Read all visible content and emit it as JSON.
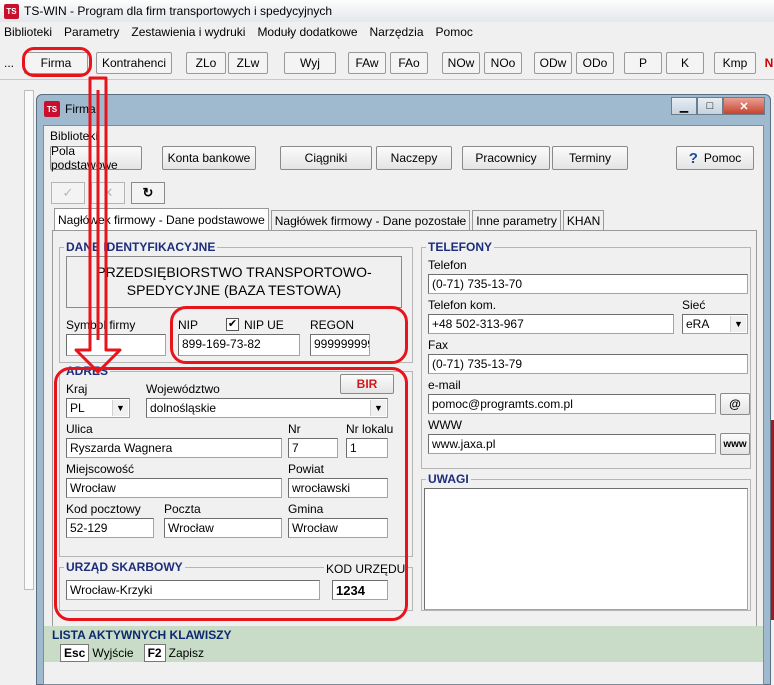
{
  "app": {
    "title": "TS-WIN - Program dla firm transportowych i spedycyjnych",
    "logo": "TS",
    "menu": [
      "Biblioteki",
      "Parametry",
      "Zestawienia i wydruki",
      "Moduły dodatkowe",
      "Narzędzia",
      "Pomoc"
    ],
    "toolbar": [
      "...",
      "Firma",
      "Kontrahenci",
      "ZLo",
      "ZLw",
      "Wyj",
      "FAw",
      "FAo",
      "NOw",
      "NOo",
      "ODw",
      "ODo",
      "P",
      "K",
      "Kmp",
      "N"
    ]
  },
  "window": {
    "title": "Firma",
    "menu": [
      "Biblioteki"
    ],
    "buttons": [
      "Pola podstawowe",
      "Konta bankowe",
      "Ciągniki",
      "Naczepy",
      "Pracownicy",
      "Terminy",
      "Pomoc"
    ],
    "tabs": [
      "Nagłówek firmowy - Dane podstawowe",
      "Nagłówek firmowy - Dane pozostałe",
      "Inne parametry",
      "KHAN"
    ]
  },
  "identification": {
    "title": "DANE IDENTYFIKACYJNE",
    "company_name": "PRZEDSIĘBIORSTWO TRANSPORTOWO-SPEDYCYJNE (BAZA TESTOWA)",
    "symbol_label": "Symbol firmy",
    "symbol_value": "",
    "nip_label": "NIP",
    "nip_ue_label": "NIP UE",
    "nip_ue_checked": "✔",
    "nip_value": "899-169-73-82",
    "regon_label": "REGON",
    "regon_value": "999999999"
  },
  "address": {
    "title": "ADRES",
    "bir_label": "BIR",
    "country_label": "Kraj",
    "country_value": "PL",
    "voivodeship_label": "Województwo",
    "voivodeship_value": "dolnośląskie",
    "street_label": "Ulica",
    "street_value": "Ryszarda Wagnera",
    "number_label": "Nr",
    "number_value": "7",
    "unit_label": "Nr lokalu",
    "unit_value": "1",
    "city_label": "Miejscowość",
    "city_value": "Wrocław",
    "county_label": "Powiat",
    "county_value": "wrocławski",
    "postal_label": "Kod pocztowy",
    "postal_value": "52-129",
    "post_label": "Poczta",
    "post_value": "Wrocław",
    "commune_label": "Gmina",
    "commune_value": "Wrocław"
  },
  "tax_office": {
    "title": "URZĄD SKARBOWY",
    "value": "Wrocław-Krzyki",
    "code_label": "KOD URZĘDU",
    "code_value": "1234"
  },
  "phones": {
    "title": "TELEFONY",
    "phone_label": "Telefon",
    "phone_value": "(0-71) 735-13-70",
    "mobile_label": "Telefon kom.",
    "mobile_value": "+48 502-313-967",
    "network_label": "Sieć",
    "network_value": "eRA",
    "fax_label": "Fax",
    "fax_value": "(0-71) 735-13-79",
    "email_label": "e-mail",
    "email_value": "pomoc@programts.com.pl",
    "email_btn": "@",
    "www_label": "WWW",
    "www_value": "www.jaxa.pl",
    "www_btn": "www"
  },
  "notes": {
    "title": "UWAGI",
    "value": ""
  },
  "shortcuts": {
    "title": "LISTA AKTYWNYCH KLAWISZY",
    "keys": [
      {
        "key": "Esc",
        "label": "Wyjście"
      },
      {
        "key": "F2",
        "label": "Zapisz"
      }
    ]
  },
  "colors": {
    "highlight": "#e8141c",
    "group_title": "#1c2d7a",
    "window_frame": "#9fb9cf",
    "keys_bar": "#c9dcc7"
  }
}
